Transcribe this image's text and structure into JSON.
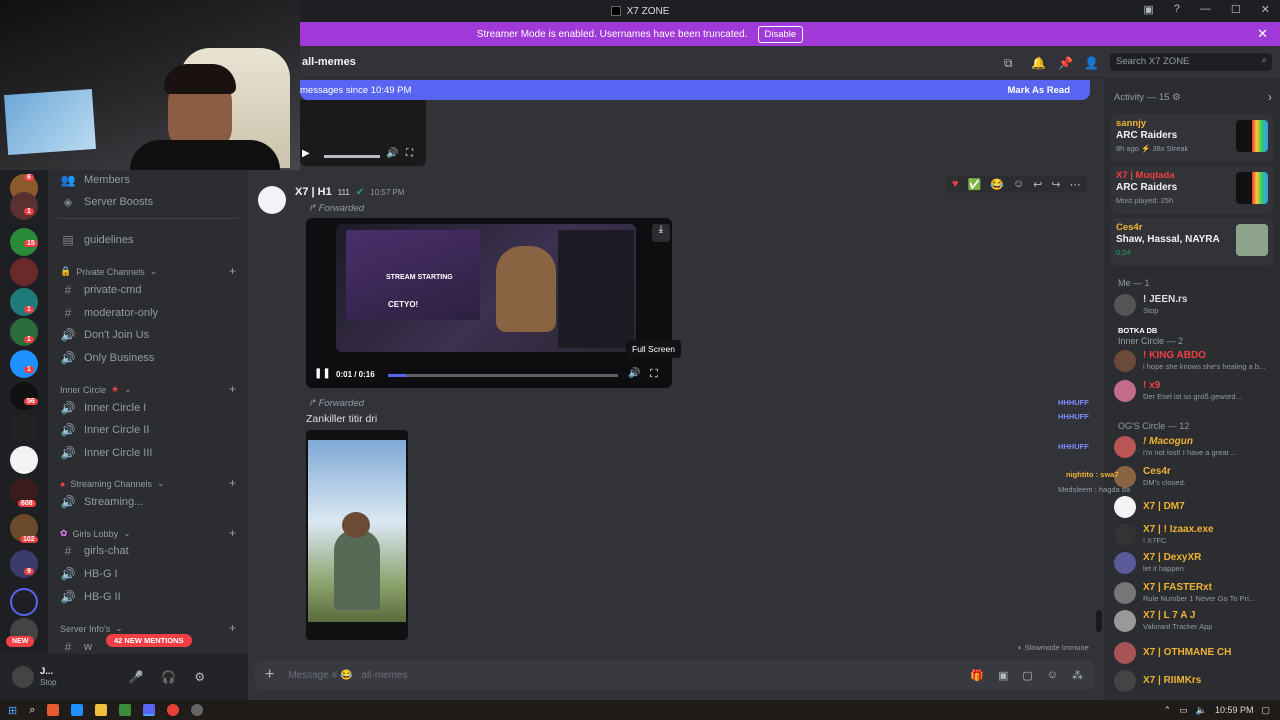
{
  "window": {
    "title": "X7 ZONE"
  },
  "banner": {
    "text": "Streamer Mode is enabled. Usernames have been truncated.",
    "button": "Disable"
  },
  "channel": {
    "name": "all-memes",
    "new_messages": "messages since 10:49 PM",
    "mark_as_read": "Mark As Read"
  },
  "search": {
    "placeholder": "Search X7 ZONE"
  },
  "sidebar": {
    "top_items": [
      {
        "label": "Members"
      },
      {
        "label": "Server Boosts"
      },
      {
        "label": "guidelines"
      }
    ],
    "categories": {
      "private": "Private Channels",
      "inner": "Inner Circle",
      "streaming": "Streaming Channels",
      "girls": "Girls Lobby",
      "server": "Server Info's"
    },
    "channels": {
      "private_cmd": "private-cmd",
      "moderator_only": "moderator-only",
      "dont_join": "Don't Join Us",
      "only_business": "Only Business",
      "ic1": "Inner Circle I",
      "ic2": "Inner Circle II",
      "ic3": "Inner Circle III",
      "streaming": "Streaming...",
      "girls_chat": "girls-chat",
      "hbg1": "HB-G I",
      "hbg2": "HB-G II",
      "info": "w"
    },
    "mentions_pill": "42 NEW MENTIONS",
    "new_pill": "NEW"
  },
  "guild_badges": [
    "6",
    "1",
    "15",
    "1",
    "1",
    "1",
    "56",
    "1",
    "608",
    "102",
    "9"
  ],
  "user_panel": {
    "name": "J...",
    "status": "Stop"
  },
  "message1": {
    "author": "X7 | H1",
    "tag": "111",
    "time": "10:57 PM",
    "forwarded": "Forwarded",
    "video_time": "0:01 / 0:16",
    "tooltip": "Full Screen",
    "video_caption_1": "STREAM STARTING",
    "video_caption_2": "CETYO!"
  },
  "message2": {
    "forwarded": "Forwarded",
    "text": "Zankiller  titir dri"
  },
  "slowmode": "Slowmode Immune",
  "composer": {
    "placeholder": "Message # 😂 · all-memes"
  },
  "members": {
    "activity_header": "Activity — 15",
    "activities": [
      {
        "name": "sannjy",
        "game": "ARC Raiders",
        "meta": "8h ago  ⚡ 38x Streak"
      },
      {
        "name": "X7 | Muqtada",
        "game": "ARC Raiders",
        "meta": "Most played: 25h"
      },
      {
        "name": "Ces4r",
        "game": "Shaw, Hassal, NAYRA",
        "meta": "0:24"
      }
    ],
    "me_header": "Me — 1",
    "me": {
      "name": "! JEEN.rs",
      "tag": "X7",
      "status": "Stop"
    },
    "inner_header": "Inner Circle — 2",
    "inner": [
      {
        "name": "! KING ABDO",
        "status": "i hope she knows she's healing a b..."
      },
      {
        "name": "! x9",
        "tag": "VxG",
        "status": "Der Esel ist so groß geword..."
      }
    ],
    "og_header": "OG'S Circle — 12",
    "og": [
      {
        "name": "! Macogun",
        "tag": "BMW",
        "status": "i'm not lost! I have a great ..."
      },
      {
        "name": "Ces4r",
        "status": "DM's closed."
      },
      {
        "name": "X7 |        DM7",
        "tag": "X7",
        "status": ""
      },
      {
        "name": "X7 | ! Izaax.exe",
        "tag": "B2K",
        "status": "! X7FC"
      },
      {
        "name": "X7 | DexyXR",
        "tag": "PSG",
        "status": "let it happen"
      },
      {
        "name": "X7 | FASTERxt",
        "status": "Rule Number 1 Never Go To Pri..."
      },
      {
        "name": "X7 | L 7 A J",
        "tag": "COD",
        "status": "Valorant Tracker App"
      },
      {
        "name": "X7 | OTHMANE CH",
        "status": ""
      },
      {
        "name": "X7 | RIIMKrs",
        "tag": "X7",
        "status": ""
      }
    ]
  },
  "stream_overlay": [
    "BOTKA DB",
    "HHHUFF",
    "HHHUFF",
    "HHHUFF",
    "nightito : swa7",
    "Medsleem : hagda da"
  ],
  "taskbar": {
    "time": "10:59 PM"
  }
}
